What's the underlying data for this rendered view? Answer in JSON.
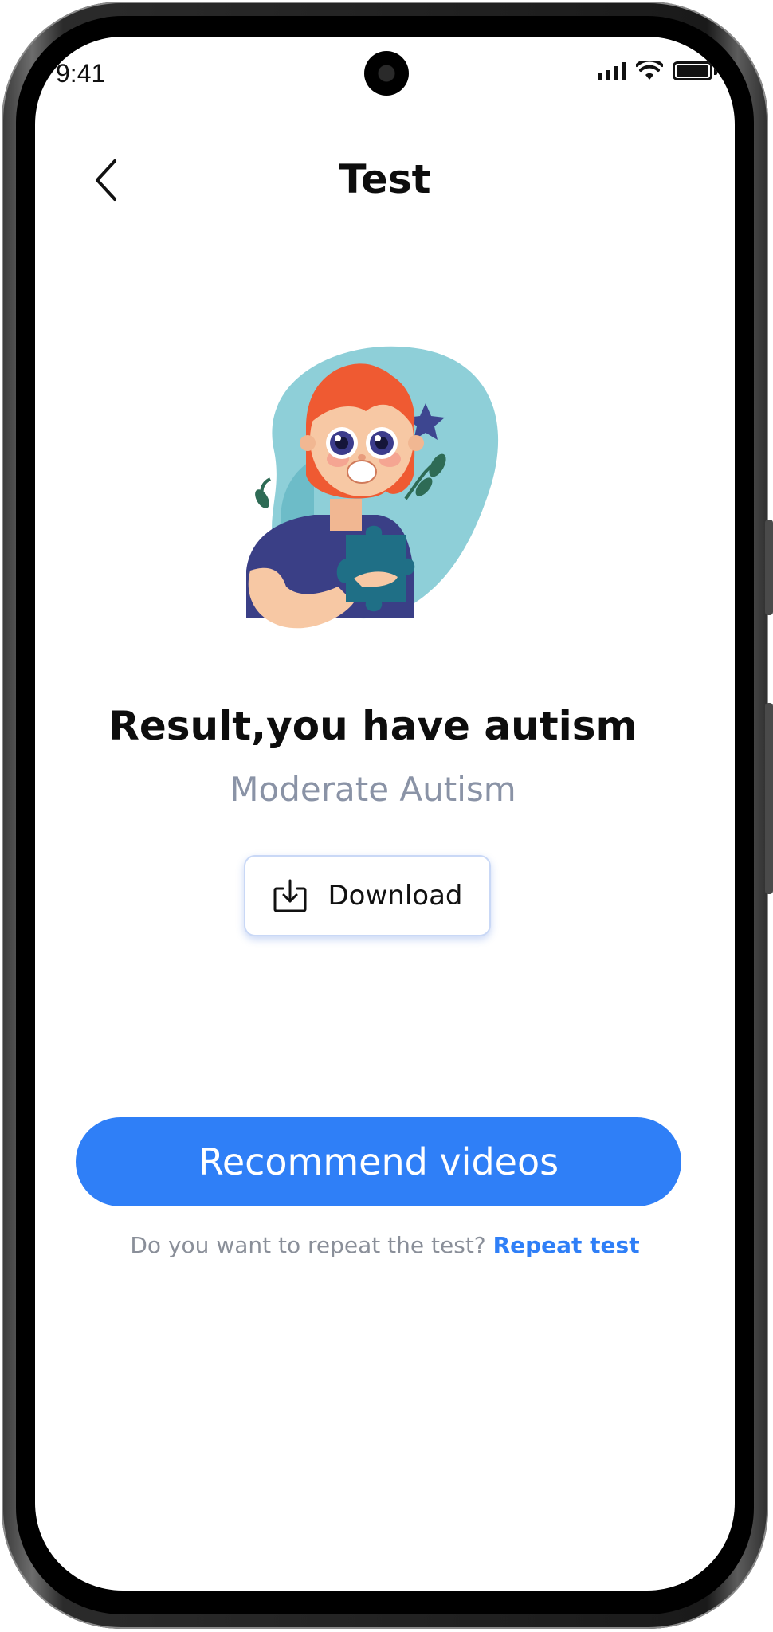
{
  "status_bar": {
    "time": "9:41"
  },
  "header": {
    "title": "Test",
    "back_icon": "chevron-left-icon"
  },
  "result": {
    "title": "Result,you have autism",
    "level": "Moderate Autism"
  },
  "download": {
    "label": "Download",
    "icon": "download-icon"
  },
  "primary_button": {
    "label": "Recommend videos"
  },
  "repeat": {
    "question": "Do you want to repeat the test?",
    "link_label": "Repeat test"
  },
  "colors": {
    "accent": "#2f7ff7",
    "muted_text": "#8a93a6",
    "illustration_blob": "#8ecfd8",
    "puzzle_piece": "#1f6f86",
    "hair": "#ef5a32",
    "shirt": "#3a3f86",
    "star": "#3d4690"
  }
}
